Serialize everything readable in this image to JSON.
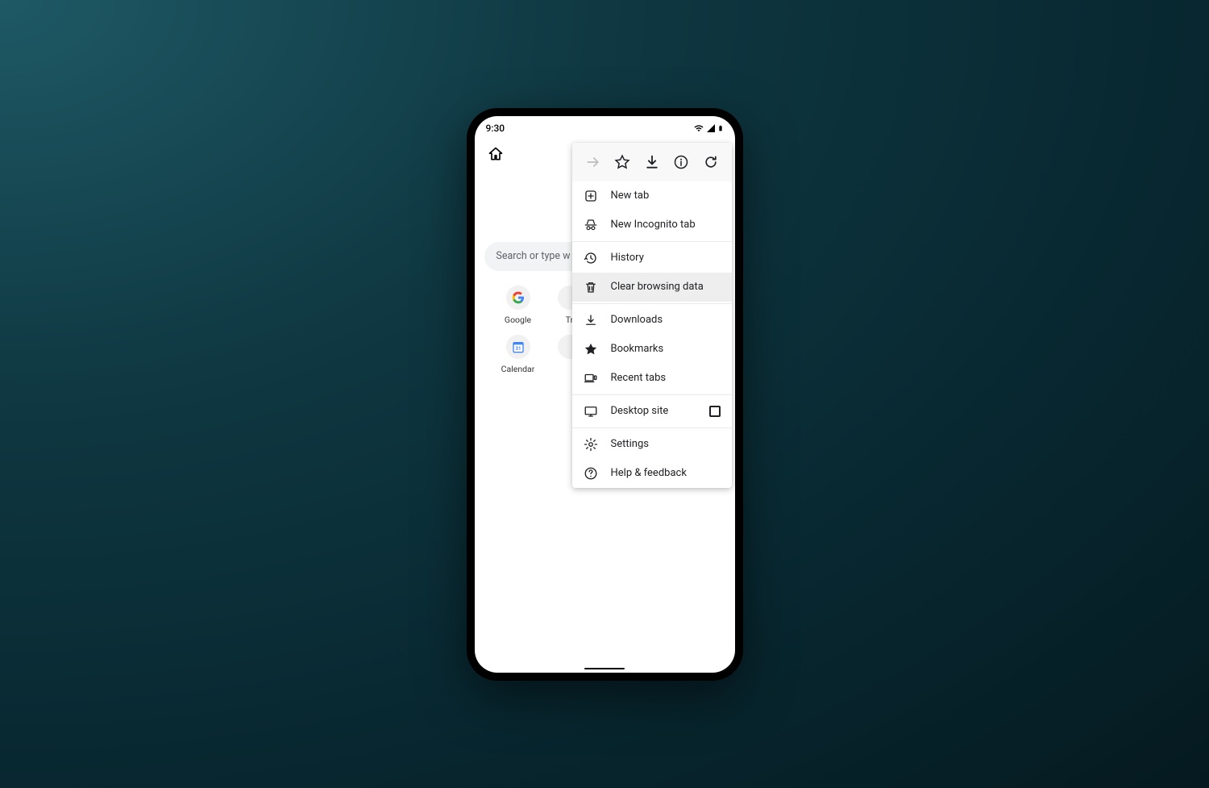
{
  "status_bar": {
    "time": "9:30"
  },
  "search": {
    "placeholder": "Search or type w"
  },
  "shortcuts": [
    {
      "label": "Google"
    },
    {
      "label": "Tr"
    },
    {
      "label": "Calendar"
    },
    {
      "label": ""
    }
  ],
  "menu": {
    "items": [
      {
        "key": "new_tab",
        "label": "New tab"
      },
      {
        "key": "new_incognito",
        "label": "New Incognito tab"
      },
      {
        "key": "history",
        "label": "History"
      },
      {
        "key": "clear_data",
        "label": "Clear browsing data",
        "highlighted": true
      },
      {
        "key": "downloads",
        "label": "Downloads"
      },
      {
        "key": "bookmarks",
        "label": "Bookmarks"
      },
      {
        "key": "recent_tabs",
        "label": "Recent tabs"
      },
      {
        "key": "desktop_site",
        "label": "Desktop site"
      },
      {
        "key": "settings",
        "label": "Settings"
      },
      {
        "key": "help",
        "label": "Help & feedback"
      }
    ]
  }
}
